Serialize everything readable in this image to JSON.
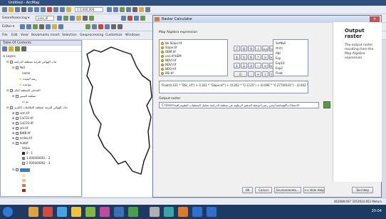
{
  "window": {
    "title": "Untitled - ArcMap"
  },
  "menu": [
    "File",
    "Edit",
    "View",
    "Bookmarks",
    "Insert",
    "Selection",
    "Geoprocessing",
    "Customize",
    "Windows"
  ],
  "toolbars": {
    "georeferencing_label": "Georeferencing ▾",
    "editor_label": "Editor ▾",
    "layer_dropdown": "junx_dl",
    "scale": "1:1,000,000"
  },
  "toc": {
    "title": "Table Of Contents",
    "layers_label": "Layers",
    "items": [
      "ثبات الهوائي للترتبة بمنطقة الدراسة",
      "fwd",
      "name",
      "رشة البعيدة",
      "مواعدة",
      "الصدقي المنطقة البكر",
      "منطقة السبير",
      "تم",
      "ثبات الهوائي للترتبة بمنطقة التطابقات الكبرى",
      "ssm.tif",
      "CaCO3.tif",
      "CaCO3.tif",
      "om.tif",
      "NWB.tif",
      "ecdeo.tif",
      "nutblf",
      "Value",
      "0 - 1",
      "1.000000001 - 2",
      "2.000000002 - 3"
    ]
  },
  "dialog": {
    "title": "Raster Calculator",
    "algebra_label": "Map Algebra expression",
    "layers_label": "Layers and variables",
    "layers": [
      "No Slope.tif",
      "Slope.tif",
      "OBM.tif",
      "uno.tif-bEM",
      "NDVI.tif",
      "NDVI.tif",
      "NDSI.tif",
      "BSI.tif"
    ],
    "operators": [
      "7",
      "8",
      "9",
      "/",
      "==",
      "!=",
      "&",
      "4",
      "5",
      "6",
      "*",
      ">",
      ">=",
      "|",
      "1",
      "2",
      "3",
      "-",
      "<",
      "<=",
      "^",
      "0",
      ".",
      "+",
      "(",
      ")",
      "~"
    ],
    "conditional_label": "Conditional —",
    "functions": [
      "SetNull",
      "Math",
      "Abs",
      "Exp",
      "Exp10",
      "Exp2",
      "Float"
    ],
    "expression": "Float(0.431 * \"BSI_.tif\") + 0.161 * \"Slope.tif\") + (0.262 * \"0.1125\") + (0.096 * \"0.27700101\") - (0.062 * \"NDVI.tif\")",
    "output_label": "Output raster",
    "output_path": "C:\\Users\\الاحتمالات\\الهشاشة\\دوس رضى\\حوصلة التدهور الرطوبة في منطقة الدراسة بتحليل المعطيات الطبوغرافية",
    "buttons": {
      "ok": "OK",
      "cancel": "Cancel",
      "environments": "Environments...",
      "hide_help": "<< Hide Help",
      "tool_help": "Tool Help"
    },
    "help_title": "Output raster",
    "help_text": "The output raster resulting from the Map Algebra expression."
  },
  "status": {
    "coords": "462689.697  3353924.852 Meters"
  },
  "taskbar": {
    "time": "20:04"
  },
  "colors": {
    "title_bar": "#2f4f7f",
    "taskbar": "#1d3a63",
    "dialog_bg": "#f0f0f0"
  }
}
